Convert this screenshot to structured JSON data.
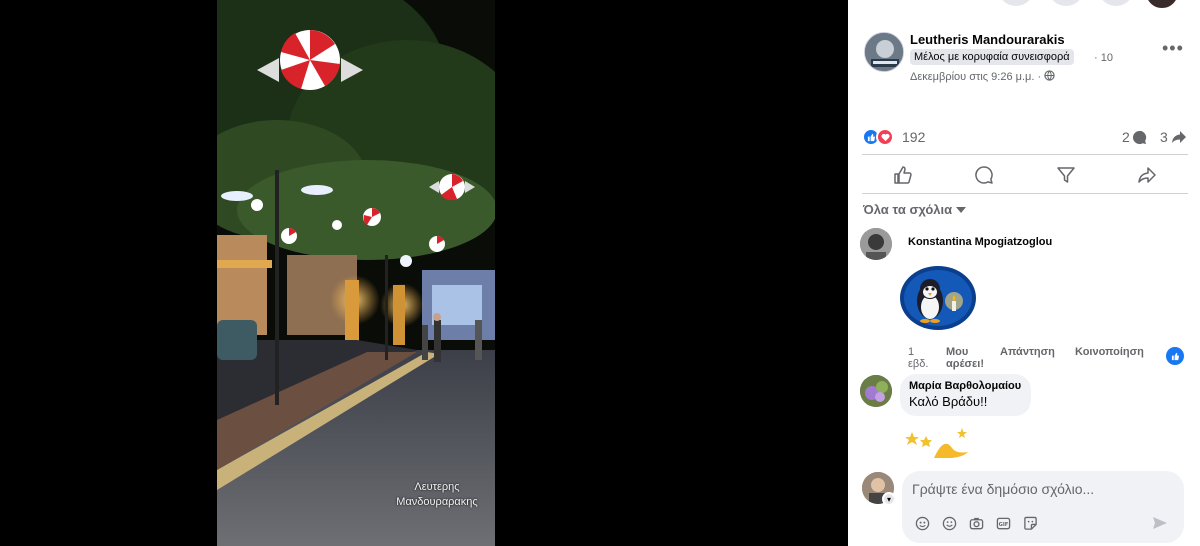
{
  "photo": {
    "watermark_line1": "Λευτερης",
    "watermark_line2": "Μανδουραρακης"
  },
  "post": {
    "author": "Leutheris Mandourarakis",
    "badge": "Μέλος με κορυφαία συνεισφορά",
    "date_part1": "· 10",
    "date_part2": "Δεκεμβρίου στις 9:26 μ.μ. ·",
    "privacy_icon": "globe-icon",
    "more_icon": "more-dots-icon",
    "more_label": "•••"
  },
  "stats": {
    "reaction_count": "192",
    "comment_count": "2",
    "share_count": "3",
    "reaction_icons": [
      "like-icon",
      "love-icon"
    ]
  },
  "actions": [
    {
      "name": "like-action",
      "icon": "thumbs-up-icon"
    },
    {
      "name": "comment-action",
      "icon": "comment-bubble-icon"
    },
    {
      "name": "send-action",
      "icon": "funnel-send-icon"
    },
    {
      "name": "share-action",
      "icon": "share-arrow-icon"
    }
  ],
  "comments_filter": {
    "label": "Όλα τα σχόλια",
    "icon": "caret-down-icon"
  },
  "comments": [
    {
      "author": "Konstantina Mpogiatzoglou",
      "sticker": "penguin-candle-sticker",
      "age_line1": "1",
      "age_line2": "εβδ.",
      "like_label_line1": "Μου",
      "like_label_line2": "αρέσει!",
      "reply_label": "Απάντηση",
      "share_label": "Κοινοποίηση",
      "reaction": "like-icon"
    },
    {
      "author": "Μαρία Βαρθολομαίου",
      "text": "Καλό Βράδυ!!",
      "sticker": "stars-moon-sticker"
    }
  ],
  "composer": {
    "placeholder": "Γράψτε ένα δημόσιο σχόλιο...",
    "tools": [
      "avatar-sticker-icon",
      "emoji-icon",
      "camera-icon",
      "gif-icon",
      "sticker-icon"
    ],
    "send_icon": "send-icon"
  },
  "colors": {
    "accent": "#1877f2",
    "love": "#f33e58",
    "secondary_text": "#65676b",
    "bubble": "#f0f2f5"
  }
}
